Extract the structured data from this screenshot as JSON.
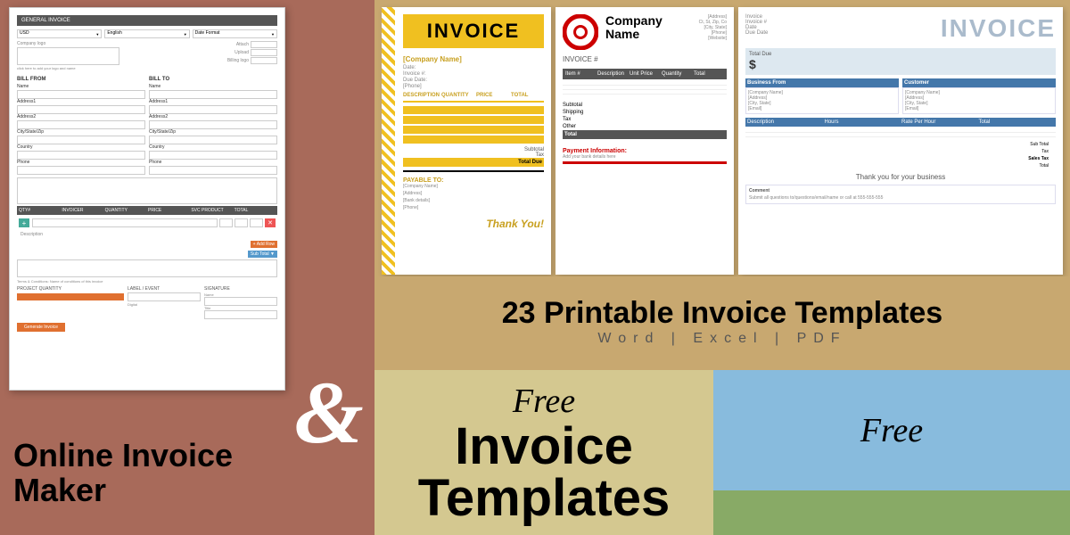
{
  "left": {
    "online_invoice_maker": "Online Invoice\nMaker",
    "ampersand": "&"
  },
  "templates": {
    "t1": {
      "title": "INVOICE",
      "company": "[Company Name]",
      "date_label": "Date:",
      "invoice_label": "Invoice #:",
      "due_label": "Due Date:",
      "phone_label": "[Phone]",
      "desc_label": "DESCRIPTION",
      "qty_label": "QUANTITY",
      "price_label": "PRICE",
      "total_label": "TOTAL",
      "subtotal": "Subtotal",
      "tax": "Tax",
      "total_due": "Total Due",
      "payable_to": "PAYABLE TO:",
      "thankyou": "Thank You!"
    },
    "t2": {
      "company_name": "Company\nName",
      "invoice_hash": "INVOICE #",
      "address_lines": [
        "[Address]",
        "Ct, St, Zip, Co",
        "[City, State]",
        "[Phone]",
        "[Website]"
      ],
      "col_headers": [
        "Item #",
        "Description",
        "Unit Price",
        "Quantity",
        "Total"
      ],
      "summary_items": [
        "Subtotal",
        "Shipping",
        "Tax",
        "Other",
        "Total"
      ],
      "payment_info": "Payment Information:",
      "payment_subtext": "Add your bank details here"
    },
    "t3": {
      "title": "INVOICE",
      "total_due_label": "Total Due",
      "dollar_sign": "$",
      "from_label": "Business From",
      "to_label": "Customer",
      "col_headers": [
        "Description",
        "Hours",
        "Rate Per Hour",
        "Total"
      ],
      "thankyou": "Thank you for your business",
      "note_label": "Comment"
    }
  },
  "headline": {
    "main": "23 Printable Invoice Templates",
    "sub": "Word  |  Excel  |  PDF"
  },
  "bottom": {
    "free": "Free",
    "invoice_templates": "Invoice Templates"
  }
}
